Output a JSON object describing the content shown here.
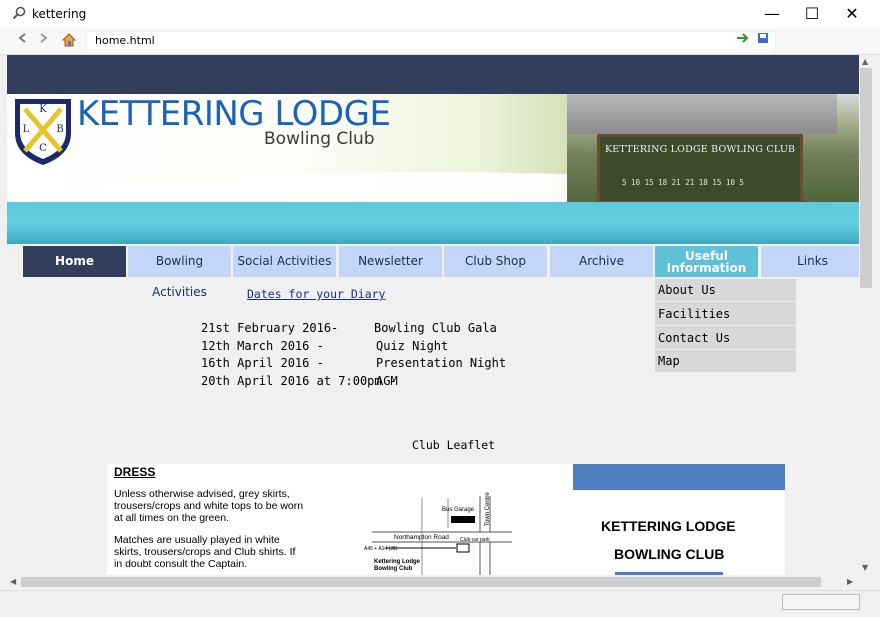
{
  "window": {
    "title": "kettering",
    "controls": {
      "minimize": "—",
      "maximize": "☐",
      "close": "✕"
    }
  },
  "toolbar": {
    "back_icon": "back-arrow-icon",
    "forward_icon": "forward-arrow-icon",
    "home_icon": "home-icon",
    "address": "home.html",
    "go_icon": "go-arrow-icon",
    "favorite_icon": "save-icon"
  },
  "site": {
    "logo_letters": {
      "top": "K",
      "left": "L",
      "right": "B",
      "bottom": "C"
    },
    "brand_name": "KETTERING LODGE",
    "brand_sub": "Bowling Club",
    "photo_sign": "KETTERING LODGE BOWLING CLUB",
    "photo_scoreboard": "5 10 15 18 21  21 18 15 10 5",
    "colors": {
      "topbar": "#333d5c",
      "teal": "#5ec9db",
      "nav": "#c3d6f8",
      "nav_active": "#333d5c",
      "nav_hover": "#60c0d8",
      "brand": "#1a63b5"
    }
  },
  "nav": {
    "items": [
      {
        "label": "Home"
      },
      {
        "label": "Bowling Activities"
      },
      {
        "label": "Social Activities"
      },
      {
        "label": "Newsletter"
      },
      {
        "label": "Club Shop"
      },
      {
        "label": "Archive"
      },
      {
        "label": "Useful Information"
      },
      {
        "label": "Links"
      }
    ],
    "active": "Home",
    "hovered": "Useful Information",
    "submenu": [
      {
        "label": "About Us"
      },
      {
        "label": "Facilities"
      },
      {
        "label": "Contact Us"
      },
      {
        "label": "Map"
      }
    ]
  },
  "diary": {
    "link": "Dates for your Diary",
    "events": [
      {
        "date": "21st February 2016-",
        "event": "Bowling Club Gala"
      },
      {
        "date": "12th March 2016 -",
        "event": "Quiz Night"
      },
      {
        "date": "16th April 2016 -",
        "event": "Presentation Night"
      },
      {
        "date": "20th April 2016 at 7:00pm -",
        "event": "AGM"
      }
    ]
  },
  "leaflet": {
    "title": "Club Leaflet",
    "dress_heading": "DRESS",
    "dress_p1": "Unless otherwise advised, grey skirts, trousers/crops and white tops to be worn at all times on the green.",
    "dress_p2": "Matches are usually played in white skirts, trousers/crops and Club shirts. If in doubt consult the Captain.",
    "map_labels": {
      "bus_garage": "Bus Garage",
      "town_centre": "Town Centre",
      "road": "Northampton Road",
      "car_park": "Club car park",
      "a45": "A45 + A14 (J8)",
      "club_line1": "Kettering Lodge",
      "club_line2": "Bowling Club"
    },
    "club_name_line1": "KETTERING LODGE",
    "club_name_line2": "BOWLING CLUB"
  }
}
